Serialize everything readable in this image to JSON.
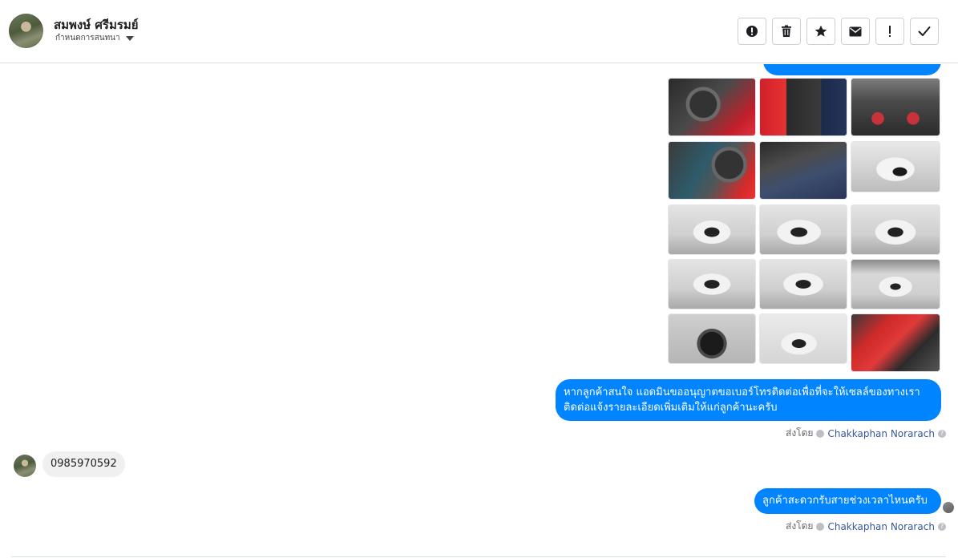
{
  "header": {
    "contact_name": "สมพงษ์ ศรีมรมย์",
    "label_select": "กำหนดการสนทนา",
    "toolbar": [
      {
        "name": "spam-button",
        "icon": "alert-circle-icon",
        "glyph": "!"
      },
      {
        "name": "delete-button",
        "icon": "trash-icon",
        "glyph": ""
      },
      {
        "name": "star-button",
        "icon": "star-icon",
        "glyph": "★"
      },
      {
        "name": "unread-button",
        "icon": "envelope-icon",
        "glyph": ""
      },
      {
        "name": "follow-up-button",
        "icon": "exclamation-icon",
        "glyph": "!"
      },
      {
        "name": "done-button",
        "icon": "check-icon",
        "glyph": "✓"
      }
    ]
  },
  "messages": [
    {
      "type": "photo-grid",
      "count": 15
    },
    {
      "type": "outgoing",
      "text": "หากลูกค้าสนใจ แอดมินขออนุญาตขอเบอร์โทรติดต่อเพื่อที่จะให้เซลล์ของทางเรา ติดต่อแจ้งรายละเอียดเพิ่มเติมให้แก่ลูกค้านะครับ",
      "sent_by_label": "ส่งโดย",
      "agent": "Chakkaphan Norarach"
    },
    {
      "type": "incoming",
      "text": "0985970592"
    },
    {
      "type": "outgoing",
      "text": "ลูกค้าสะดวกรับสายช่วงเวลาไหนครับ",
      "sent_by_label": "ส่งโดย",
      "agent": "Chakkaphan Norarach"
    }
  ],
  "colors": {
    "accent": "#0084ff",
    "incoming_bg": "#f0f0f0",
    "agent_link": "#385898",
    "muted": "#65676b"
  }
}
